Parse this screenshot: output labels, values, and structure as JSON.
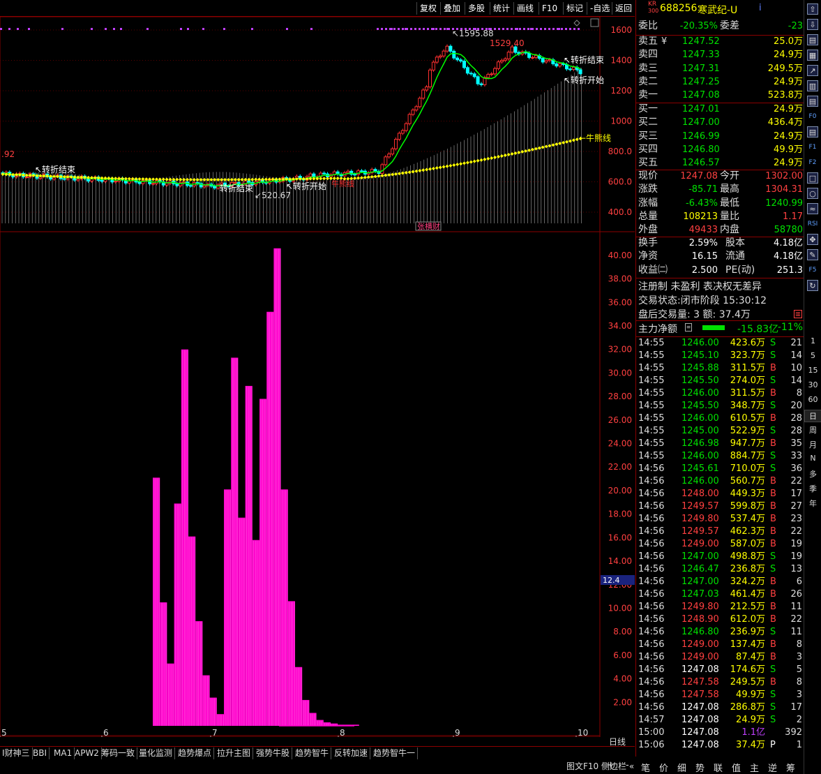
{
  "toolbar": {
    "buttons": [
      "复权",
      "叠加",
      "多股",
      "统计",
      "画线",
      "F10",
      "标记",
      "-自选",
      "返回"
    ]
  },
  "stock": {
    "index_badge_top": "KR",
    "index_badge_bottom": "300",
    "code": "688256",
    "name": "寒武纪-U",
    "info_icon": "i"
  },
  "order_book": {
    "weibi_label": "委比",
    "weibi_value": "-20.35%",
    "weicha_label": "委差",
    "weicha_value": "-23",
    "asks": [
      {
        "label": "卖五",
        "mark": "¥",
        "price": "1247.52",
        "volume": "25.0万"
      },
      {
        "label": "卖四",
        "mark": "",
        "price": "1247.33",
        "volume": "24.9万"
      },
      {
        "label": "卖三",
        "mark": "",
        "price": "1247.31",
        "volume": "249.5万"
      },
      {
        "label": "卖二",
        "mark": "",
        "price": "1247.25",
        "volume": "24.9万"
      },
      {
        "label": "卖一",
        "mark": "",
        "price": "1247.08",
        "volume": "523.8万"
      }
    ],
    "bids": [
      {
        "label": "买一",
        "price": "1247.01",
        "volume": "24.9万"
      },
      {
        "label": "买二",
        "price": "1247.00",
        "volume": "436.4万"
      },
      {
        "label": "买三",
        "price": "1246.99",
        "volume": "24.9万"
      },
      {
        "label": "买四",
        "price": "1246.80",
        "volume": "49.9万"
      },
      {
        "label": "买五",
        "price": "1246.57",
        "volume": "24.9万"
      }
    ]
  },
  "quote": [
    {
      "l1": "现价",
      "v1": "1247.08",
      "c1": "red",
      "l2": "今开",
      "v2": "1302.00",
      "c2": "red"
    },
    {
      "l1": "涨跌",
      "v1": "-85.71",
      "c1": "green",
      "l2": "最高",
      "v2": "1304.31",
      "c2": "red"
    },
    {
      "l1": "涨幅",
      "v1": "-6.43%",
      "c1": "green",
      "l2": "最低",
      "v2": "1240.99",
      "c2": "green"
    },
    {
      "l1": "总量",
      "v1": "108213",
      "c1": "yellow",
      "l2": "量比",
      "v2": "1.17",
      "c2": "red"
    },
    {
      "l1": "外盘",
      "v1": "49433",
      "c1": "red",
      "l2": "内盘",
      "v2": "58780",
      "c2": "green"
    }
  ],
  "fundamentals": [
    {
      "l1": "换手",
      "v1": "2.59%",
      "l2": "股本",
      "v2": "4.18亿"
    },
    {
      "l1": "净资",
      "v1": "16.15",
      "l2": "流通",
      "v2": "4.18亿"
    },
    {
      "l1": "收益㈡",
      "v1": "2.500",
      "l2": "PE(动)",
      "v2": "251.3"
    }
  ],
  "notes": {
    "line1": "注册制 未盈利 表决权无差异",
    "line2": "交易状态:闭市阶段 15:30:12",
    "line3": "盘后交易量: 3  额: 37.4万"
  },
  "main_force": {
    "label": "主力净额",
    "value": "-15.83亿",
    "pct": "-11%"
  },
  "ticks": [
    {
      "t": "14:55",
      "p": "1246.00",
      "a": "423.6万",
      "s": "S",
      "n": "21"
    },
    {
      "t": "14:55",
      "p": "1245.10",
      "a": "323.7万",
      "s": "S",
      "n": "14"
    },
    {
      "t": "14:55",
      "p": "1245.88",
      "a": "311.5万",
      "s": "B",
      "n": "10"
    },
    {
      "t": "14:55",
      "p": "1245.50",
      "a": "274.0万",
      "s": "S",
      "n": "14"
    },
    {
      "t": "14:55",
      "p": "1246.00",
      "a": "311.5万",
      "s": "B",
      "n": "8"
    },
    {
      "t": "14:55",
      "p": "1245.50",
      "a": "348.7万",
      "s": "S",
      "n": "20"
    },
    {
      "t": "14:55",
      "p": "1246.00",
      "a": "610.5万",
      "s": "B",
      "n": "28"
    },
    {
      "t": "14:55",
      "p": "1245.00",
      "a": "522.9万",
      "s": "S",
      "n": "28"
    },
    {
      "t": "14:55",
      "p": "1246.98",
      "a": "947.7万",
      "s": "B",
      "n": "35"
    },
    {
      "t": "14:55",
      "p": "1246.00",
      "a": "884.7万",
      "s": "S",
      "n": "33"
    },
    {
      "t": "14:56",
      "p": "1245.61",
      "a": "710.0万",
      "s": "S",
      "n": "36"
    },
    {
      "t": "14:56",
      "p": "1246.00",
      "a": "560.7万",
      "s": "B",
      "n": "22"
    },
    {
      "t": "14:56",
      "p": "1248.00",
      "a": "449.3万",
      "s": "B",
      "n": "17"
    },
    {
      "t": "14:56",
      "p": "1249.57",
      "a": "599.8万",
      "s": "B",
      "n": "27"
    },
    {
      "t": "14:56",
      "p": "1249.80",
      "a": "537.4万",
      "s": "B",
      "n": "23"
    },
    {
      "t": "14:56",
      "p": "1249.57",
      "a": "462.3万",
      "s": "B",
      "n": "22"
    },
    {
      "t": "14:56",
      "p": "1249.00",
      "a": "587.0万",
      "s": "B",
      "n": "19"
    },
    {
      "t": "14:56",
      "p": "1247.00",
      "a": "498.8万",
      "s": "S",
      "n": "19"
    },
    {
      "t": "14:56",
      "p": "1246.47",
      "a": "236.8万",
      "s": "S",
      "n": "13"
    },
    {
      "t": "14:56",
      "p": "1247.00",
      "a": "324.2万",
      "s": "B",
      "n": "6"
    },
    {
      "t": "14:56",
      "p": "1247.03",
      "a": "461.4万",
      "s": "B",
      "n": "26"
    },
    {
      "t": "14:56",
      "p": "1249.80",
      "a": "212.5万",
      "s": "B",
      "n": "11"
    },
    {
      "t": "14:56",
      "p": "1248.90",
      "a": "612.0万",
      "s": "B",
      "n": "22"
    },
    {
      "t": "14:56",
      "p": "1246.80",
      "a": "236.9万",
      "s": "S",
      "n": "11"
    },
    {
      "t": "14:56",
      "p": "1249.00",
      "a": "137.4万",
      "s": "B",
      "n": "8"
    },
    {
      "t": "14:56",
      "p": "1249.00",
      "a": "87.4万",
      "s": "B",
      "n": "3"
    },
    {
      "t": "14:56",
      "p": "1247.08",
      "a": "174.6万",
      "s": "S",
      "n": "5"
    },
    {
      "t": "14:56",
      "p": "1247.58",
      "a": "249.5万",
      "s": "B",
      "n": "8"
    },
    {
      "t": "14:56",
      "p": "1247.58",
      "a": "49.9万",
      "s": "S",
      "n": "3"
    },
    {
      "t": "14:56",
      "p": "1247.08",
      "a": "286.8万",
      "s": "S",
      "n": "17"
    },
    {
      "t": "14:57",
      "p": "1247.08",
      "a": "24.9万",
      "s": "S",
      "n": "2"
    },
    {
      "t": "15:00",
      "p": "1247.08",
      "a": "1.1亿",
      "s": "",
      "n": "392"
    },
    {
      "t": "15:06",
      "p": "1247.08",
      "a": "37.4万",
      "s": "P",
      "n": "1"
    }
  ],
  "price_axis": [
    "1600",
    "1400",
    "1200",
    "1000",
    "800.0",
    "600.0",
    "400.0"
  ],
  "indicator_axis": [
    "40.00",
    "38.00",
    "36.00",
    "34.00",
    "32.00",
    "30.00",
    "28.00",
    "26.00",
    "24.00",
    "22.00",
    "20.00",
    "18.00",
    "16.00",
    "14.00",
    "12.00",
    "10.00",
    "8.00",
    "6.00",
    "4.00",
    "2.00"
  ],
  "indicator_marker": "12.4",
  "x_axis": [
    "5",
    "6",
    "7",
    "8",
    "9",
    "10"
  ],
  "period_label": "日线",
  "chart_annotations": {
    "high_label": "1595.88",
    "high2_label": "1529.40",
    "low_label": "520.67",
    "left_label": ".92",
    "turn_end_1": "转折结束",
    "turn_end_2": "转折结束",
    "turn_start_1": "转折开始",
    "turn_start_2": "转折开始",
    "turn_end_3": "转折结束",
    "bull_label": "牛熊线",
    "zhang_label": "张横财",
    "red_label": "牛熊线"
  },
  "bottom_tabs": [
    "I财神三",
    "BBI",
    "MA1",
    "APW2",
    "筹码一致",
    "量化监测",
    "趋势爆点",
    "拉升主图",
    "强势牛股",
    "趋势智牛",
    "反转加速",
    "趋势智牛一"
  ],
  "bottom_bar": {
    "plus": "+",
    "minus": "-",
    "f10": "图文F10",
    "side": "侧边栏 «"
  },
  "right_tabs": [
    "笔",
    "价",
    "细",
    "势",
    "联",
    "值",
    "主",
    "逆",
    "筹"
  ],
  "right_icons": [
    "up-arrow",
    "down-arrow",
    "list",
    "grid",
    "chart",
    "bar",
    "doc",
    "F10",
    "doc2",
    "F10b",
    "Fl2",
    "square",
    "circle",
    "wave",
    "RSI",
    "move",
    "pen",
    "F5",
    "refresh"
  ],
  "periods": [
    "1",
    "5",
    "15",
    "30",
    "60",
    "日",
    "周",
    "月",
    "N",
    "多",
    "季",
    "年"
  ],
  "colors": {
    "up": "#ff3030",
    "down": "#00ffff",
    "ma": "#00ff00",
    "bull": "#ffff00",
    "indicator": "#ff00cc",
    "grid": "#8b0000"
  },
  "chart_data": {
    "type": "bar",
    "note_series": "indicator histogram (lower pane)",
    "price": {
      "x_ticks": [
        "5",
        "6",
        "7",
        "8",
        "9",
        "10"
      ],
      "ylim": [
        400,
        1600
      ],
      "high": 1595.88,
      "low": 520.67,
      "secondary_high": 1529.4
    },
    "indicator": {
      "ylim": [
        0,
        41
      ],
      "values": [
        21.1,
        10.5,
        5.3,
        18.9,
        32.0,
        16.1,
        8.9,
        4.3,
        2.4,
        1.0,
        20.1,
        31.3,
        17.7,
        28.9,
        15.8,
        27.8,
        35.2,
        40.6,
        20.1,
        10.6,
        5.0,
        2.2,
        1.1,
        0.5,
        0.3,
        0.2,
        0.1,
        0.1,
        0.1
      ]
    }
  }
}
